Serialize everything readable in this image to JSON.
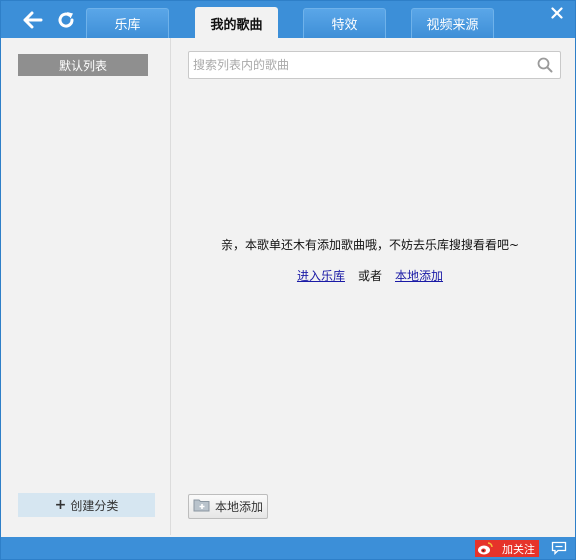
{
  "tabs": [
    {
      "label": "乐库"
    },
    {
      "label": "我的歌曲"
    },
    {
      "label": "特效"
    },
    {
      "label": "视频来源"
    }
  ],
  "active_tab": "我的歌曲",
  "icons": {
    "back": "back-arrow-icon",
    "refresh": "refresh-icon",
    "close": "close-icon",
    "search": "search-icon",
    "folder": "folder-add-icon",
    "weibo": "weibo-icon",
    "feedback": "chat-bubble-icon"
  },
  "sidebar": {
    "default_list": "默认列表",
    "create_category": "创建分类"
  },
  "main": {
    "search_placeholder": "搜索列表内的歌曲",
    "empty_message": "亲，本歌单还木有添加歌曲哦，不妨去乐库搜搜看看吧~",
    "link_enter_library": "进入乐库",
    "link_or": "或者",
    "link_local_add": "本地添加",
    "local_add_button": "本地添加"
  },
  "statusbar": {
    "follow_label": "加关注"
  },
  "colors": {
    "chrome_blue": "#3c8fd8",
    "link_blue": "#1a1aa6",
    "follow_red": "#e6332a"
  }
}
